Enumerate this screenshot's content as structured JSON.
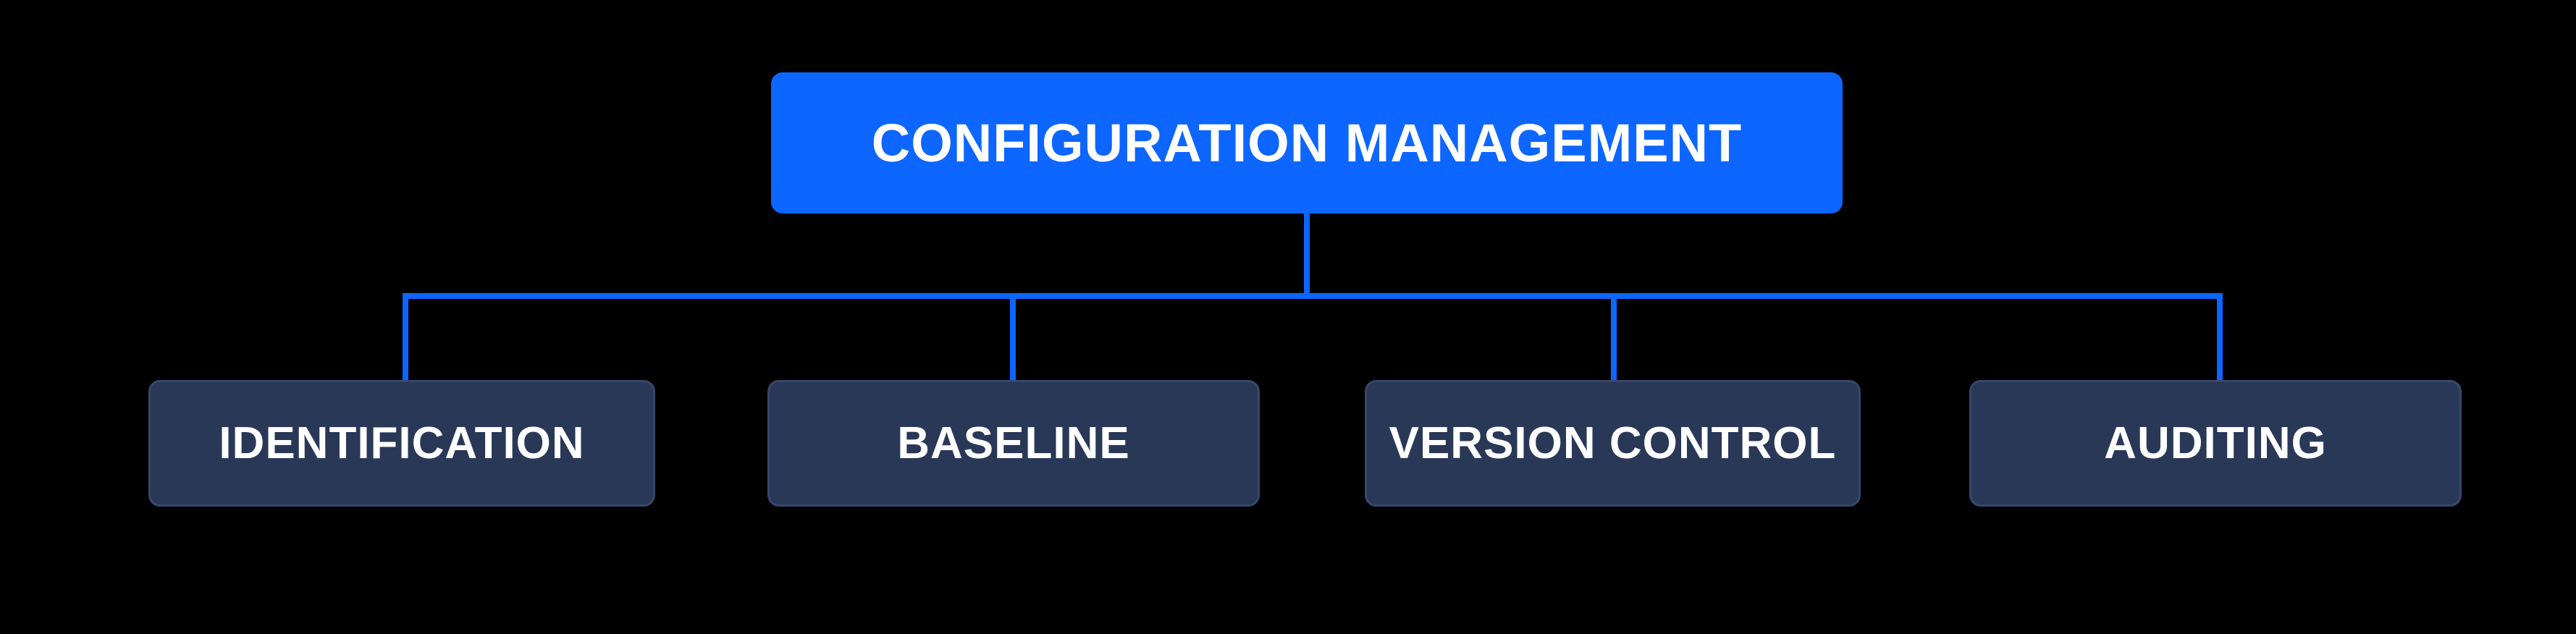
{
  "diagram": {
    "root": {
      "label": "CONFIGURATION MANAGEMENT"
    },
    "children": [
      {
        "label": "IDENTIFICATION"
      },
      {
        "label": "BASELINE"
      },
      {
        "label": "VERSION CONTROL"
      },
      {
        "label": "AUDITING"
      }
    ]
  },
  "colors": {
    "root_bg": "#0c66ff",
    "child_bg": "#293857",
    "line": "#0c66ff",
    "text": "#ffffff"
  }
}
